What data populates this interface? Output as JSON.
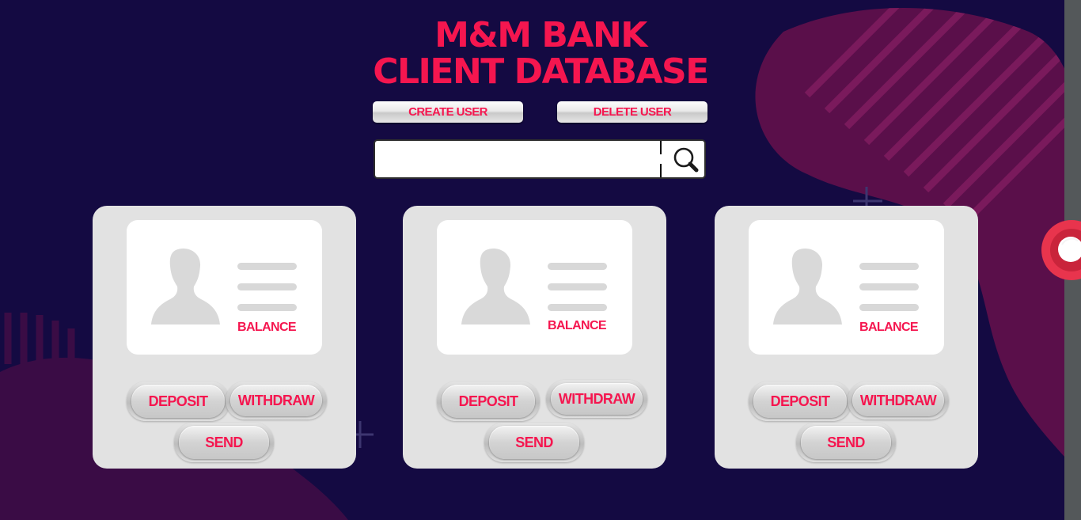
{
  "app": {
    "title_line1": "M&M BANK",
    "title_line2": "CLIENT DATABASE"
  },
  "toolbar": {
    "create_user_label": "CREATE USER",
    "delete_user_label": "DELETE USER"
  },
  "search": {
    "value": "",
    "placeholder": ""
  },
  "icons": {
    "search": "magnifier-icon",
    "avatar": "person-silhouette-icon",
    "slider": "slider-knob-icon"
  },
  "cards": [
    {
      "balance_label": "BALANCE",
      "deposit_label": "DEPOSIT",
      "withdraw_label": "WITHDRAW",
      "send_label": "SEND"
    },
    {
      "balance_label": "BALANCE",
      "deposit_label": "DEPOSIT",
      "withdraw_label": "WITHDRAW",
      "send_label": "SEND"
    },
    {
      "balance_label": "BALANCE",
      "deposit_label": "DEPOSIT",
      "withdraw_label": "WITHDRAW",
      "send_label": "SEND"
    }
  ],
  "colors": {
    "background": "#140a42",
    "accent": "#f5164f",
    "card": "#e2e2e2"
  }
}
